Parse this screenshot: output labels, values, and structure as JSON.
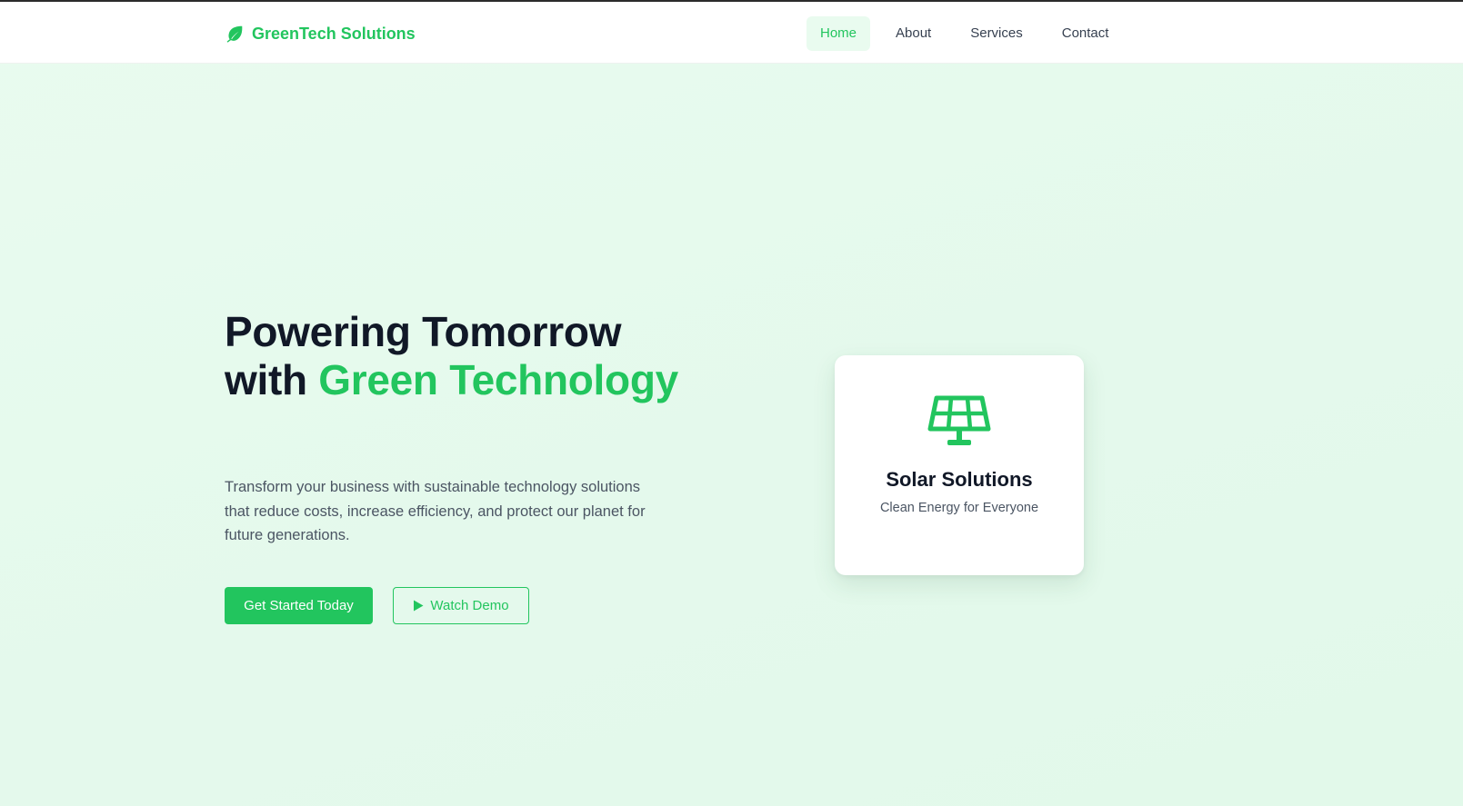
{
  "brand": {
    "name": "GreenTech Solutions",
    "icon": "leaf-icon"
  },
  "nav": {
    "items": [
      {
        "label": "Home",
        "active": true
      },
      {
        "label": "About",
        "active": false
      },
      {
        "label": "Services",
        "active": false
      },
      {
        "label": "Contact",
        "active": false
      }
    ]
  },
  "hero": {
    "title_line1": "Powering Tomorrow",
    "title_with": "with ",
    "title_accent": "Green Technology",
    "description": "Transform your business with sustainable technology solutions that reduce costs, increase efficiency, and protect our planet for future generations.",
    "primary_button": "Get Started Today",
    "secondary_button": "Watch Demo",
    "secondary_icon": "play-icon"
  },
  "card": {
    "icon": "solar-panel-icon",
    "title": "Solar Solutions",
    "subtitle": "Clean Energy for Everyone"
  },
  "colors": {
    "accent": "#22c55e",
    "text_dark": "#111827",
    "text_muted": "#4b5563",
    "hero_bg": "#e6faed"
  }
}
